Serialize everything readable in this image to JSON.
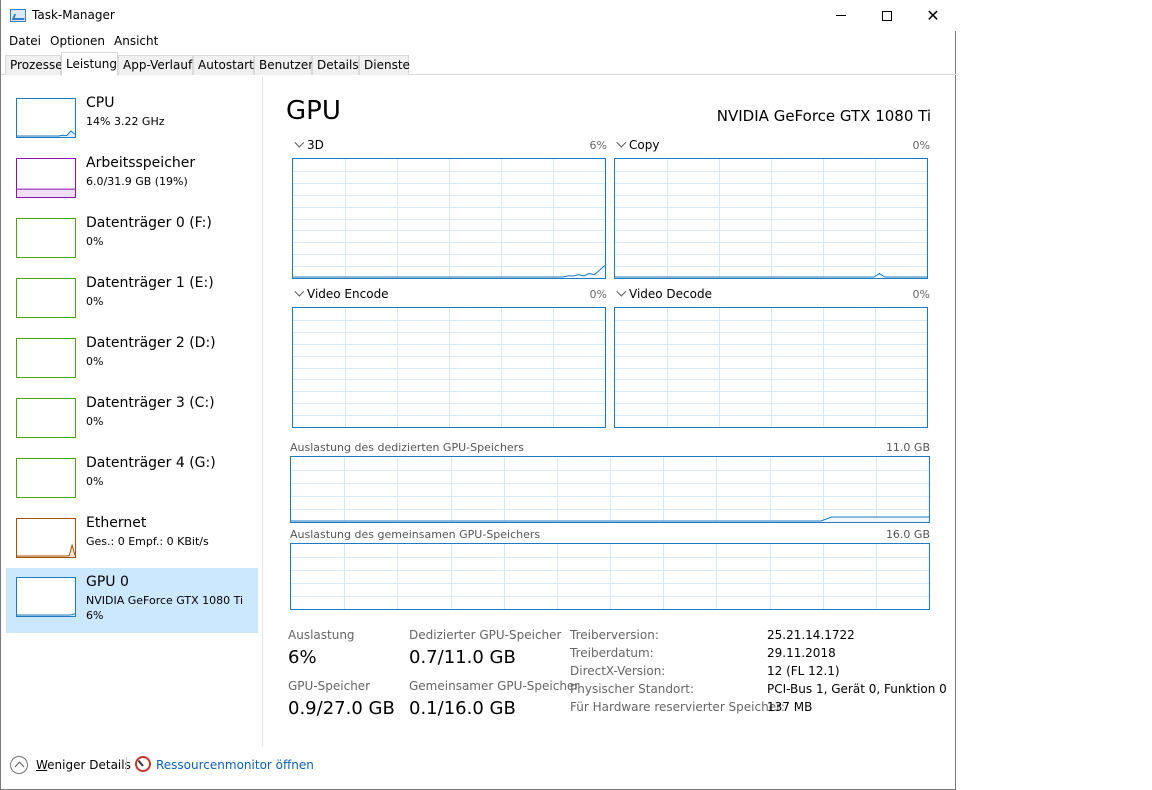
{
  "window": {
    "title": "Task-Manager"
  },
  "menu": [
    "Datei",
    "Optionen",
    "Ansicht"
  ],
  "tabs": [
    "Prozesse",
    "Leistung",
    "App-Verlauf",
    "Autostart",
    "Benutzer",
    "Details",
    "Dienste"
  ],
  "active_tab": "Leistung",
  "sidebar": [
    {
      "title": "CPU",
      "sub": "14% 3.22 GHz",
      "sub2": "",
      "color": "#1c7bc2"
    },
    {
      "title": "Arbeitsspeicher",
      "sub": "6.0/31.9 GB (19%)",
      "sub2": "",
      "color": "#8b12ae"
    },
    {
      "title": "Datenträger 0 (F:)",
      "sub": "0%",
      "sub2": "",
      "color": "#4da60c"
    },
    {
      "title": "Datenträger 1 (E:)",
      "sub": "0%",
      "sub2": "",
      "color": "#4da60c"
    },
    {
      "title": "Datenträger 2 (D:)",
      "sub": "0%",
      "sub2": "",
      "color": "#4da60c"
    },
    {
      "title": "Datenträger 3 (C:)",
      "sub": "0%",
      "sub2": "",
      "color": "#4da60c"
    },
    {
      "title": "Datenträger 4 (G:)",
      "sub": "0%",
      "sub2": "",
      "color": "#4da60c"
    },
    {
      "title": "Ethernet",
      "sub": "Ges.: 0 Empf.: 0 KBit/s",
      "sub2": "",
      "color": "#a74f01"
    },
    {
      "title": "GPU 0",
      "sub": "NVIDIA GeForce GTX 1080 Ti",
      "sub2": "6%",
      "color": "#1c7bc2"
    }
  ],
  "main": {
    "title": "GPU",
    "model": "NVIDIA GeForce GTX 1080 Ti",
    "engines": [
      {
        "name": "3D",
        "pct": "6%"
      },
      {
        "name": "Copy",
        "pct": "0%"
      },
      {
        "name": "Video Encode",
        "pct": "0%"
      },
      {
        "name": "Video Decode",
        "pct": "0%"
      }
    ],
    "dedicated_label": "Auslastung des dedizierten GPU-Speichers",
    "dedicated_max": "11.0 GB",
    "shared_label": "Auslastung des gemeinsamen GPU-Speichers",
    "shared_max": "16.0 GB"
  },
  "stats": {
    "usage_label": "Auslastung",
    "usage_value": "6%",
    "dedicated_label": "Dedizierter GPU-Speicher",
    "dedicated_value": "0.7/11.0 GB",
    "gpu_mem_label": "GPU-Speicher",
    "gpu_mem_value": "0.9/27.0 GB",
    "shared_label": "Gemeinsamer GPU-Speicher",
    "shared_value": "0.1/16.0 GB"
  },
  "info": [
    {
      "label": "Treiberversion:",
      "value": "25.21.14.1722"
    },
    {
      "label": "Treiberdatum:",
      "value": "29.11.2018"
    },
    {
      "label": "DirectX-Version:",
      "value": "12 (FL 12.1)"
    },
    {
      "label": "Physischer Standort:",
      "value": "PCI-Bus 1, Gerät 0, Funktion 0"
    },
    {
      "label": "Für Hardware reservierter Speicher:",
      "value": "137 MB"
    }
  ],
  "footer": {
    "fewer_details": "Weniger Details",
    "open_resmon": "Ressourcenmonitor öffnen"
  },
  "series": {
    "cpu": [
      0,
      0,
      0,
      0,
      0,
      0,
      0,
      0,
      0,
      0,
      0,
      2,
      1,
      14,
      5
    ],
    "ram": [
      19,
      19,
      19,
      19
    ],
    "ethernet": [
      0,
      0,
      0,
      0,
      0,
      0,
      0,
      0,
      0,
      0,
      0,
      0,
      0,
      0,
      0,
      0,
      0,
      0,
      1,
      30,
      2
    ],
    "gpu": [
      0,
      0,
      0,
      0,
      0,
      0,
      0,
      0,
      0,
      0,
      0,
      0,
      0,
      0,
      0,
      0,
      0,
      1,
      3
    ],
    "engine_3d": [
      0,
      0,
      0,
      0,
      0,
      0,
      0,
      0,
      0,
      0,
      0,
      0,
      0,
      0,
      0,
      0,
      0,
      0,
      0,
      0,
      0,
      0,
      0,
      0,
      0,
      0,
      0,
      0,
      0,
      0,
      0,
      0,
      0,
      0,
      0,
      0,
      0,
      0,
      0,
      0,
      0,
      0,
      0,
      0,
      0,
      0,
      0,
      0,
      0,
      0,
      0,
      0,
      1,
      1,
      2,
      1,
      3,
      2,
      6,
      10
    ],
    "engine_copy": [
      0,
      0,
      0,
      0,
      0,
      0,
      0,
      0,
      0,
      0,
      0,
      0,
      0,
      0,
      0,
      0,
      0,
      0,
      0,
      0,
      0,
      0,
      0,
      0,
      0,
      0,
      0,
      0,
      0,
      0,
      0,
      0,
      0,
      0,
      0,
      0,
      0,
      0,
      0,
      0,
      0,
      0,
      0,
      0,
      0,
      0,
      0,
      0,
      0,
      0,
      3,
      0,
      0,
      0,
      0,
      0,
      0,
      0,
      0,
      0
    ],
    "dedicated_mem": [
      0,
      0,
      0,
      0,
      0,
      0,
      0,
      0,
      0,
      0,
      0,
      0,
      0,
      0,
      0,
      0,
      0,
      0,
      0,
      0,
      0,
      0,
      0,
      0,
      0,
      0,
      0,
      0,
      0,
      0,
      0,
      0,
      0,
      0,
      0,
      0,
      0,
      0,
      0,
      0,
      0,
      0,
      0,
      0,
      0,
      0,
      0,
      0,
      0,
      0,
      0.7,
      0.7,
      0.7,
      0.7,
      0.7,
      0.7,
      0.7,
      0.7,
      0.7,
      0.7
    ],
    "dedicated_max": 11
  }
}
